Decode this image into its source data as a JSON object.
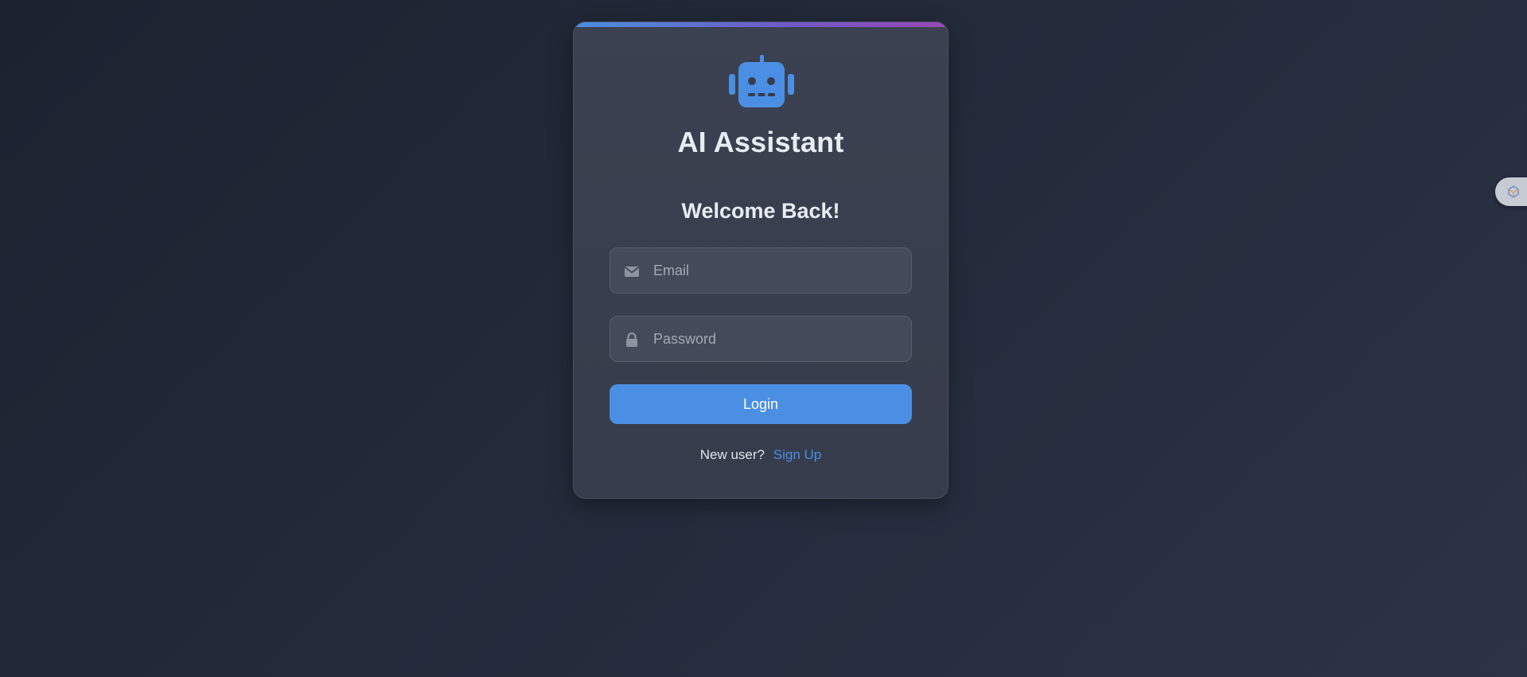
{
  "app": {
    "title": "AI Assistant",
    "logo_icon": "robot-icon"
  },
  "login_form": {
    "heading": "Welcome Back!",
    "email": {
      "placeholder": "Email",
      "value": "",
      "icon": "envelope-icon"
    },
    "password": {
      "placeholder": "Password",
      "value": "",
      "icon": "lock-icon"
    },
    "submit_label": "Login",
    "signup_prompt": "New user?",
    "signup_link": "Sign Up"
  },
  "side_widget": {
    "icon": "extension-icon"
  },
  "colors": {
    "accent": "#4a8fe3",
    "card_background": "#3b4150",
    "page_background": "#1f2533",
    "gradient_end": "#9b48b8"
  }
}
